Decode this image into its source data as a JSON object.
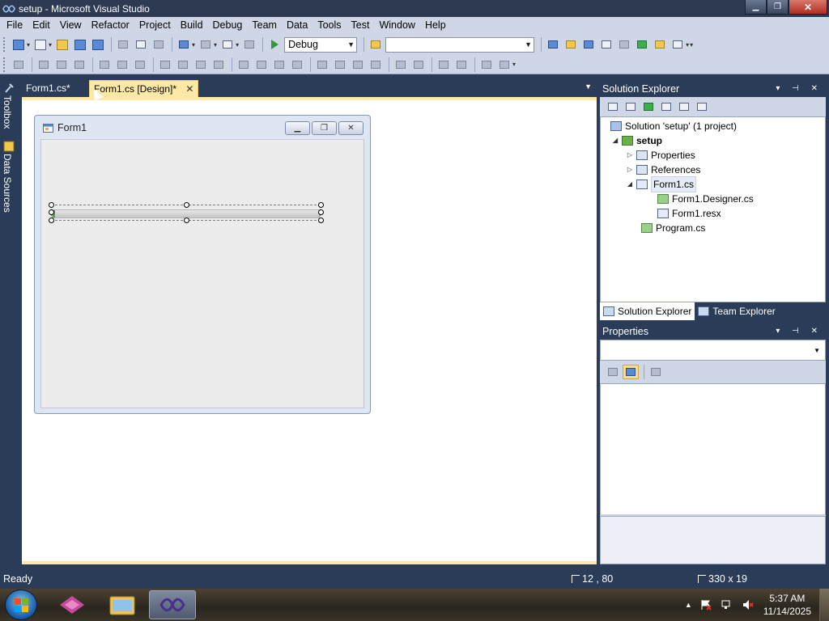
{
  "window": {
    "title": "setup - Microsoft Visual Studio",
    "min_glyph": "▁",
    "restore_glyph": "❐",
    "close_glyph": "✕"
  },
  "menu": [
    "File",
    "Edit",
    "View",
    "Refactor",
    "Project",
    "Build",
    "Debug",
    "Team",
    "Data",
    "Tools",
    "Test",
    "Window",
    "Help"
  ],
  "toolbar": {
    "configuration": "Debug",
    "find_box_value": ""
  },
  "left_strip": {
    "toolbox_label": "Toolbox",
    "data_sources_label": "Data Sources"
  },
  "doc_tabs": [
    {
      "label": "Form1.cs*",
      "active": false
    },
    {
      "label": "Form1.cs [Design]*",
      "active": true,
      "close": "✕"
    }
  ],
  "designer": {
    "form_title": "Form1",
    "progress_value": 0.01
  },
  "solution_explorer": {
    "title": "Solution Explorer",
    "pin_buttons": "▾ ⊣ ✕",
    "tree": {
      "solution": "Solution 'setup' (1 project)",
      "project": "setup",
      "properties": "Properties",
      "references": "References",
      "form1": "Form1.cs",
      "form1_designer": "Form1.Designer.cs",
      "form1_resx": "Form1.resx",
      "program": "Program.cs"
    },
    "bottom_tabs": [
      "Solution Explorer",
      "Team Explorer"
    ]
  },
  "properties_panel": {
    "title": "Properties",
    "pin_buttons": "▾ ⊣ ✕",
    "object_selector": ""
  },
  "status": {
    "text": "Ready",
    "position": "12 , 80",
    "size": "330 x 19"
  },
  "taskbar": {
    "time": "5:37 AM",
    "date": "11/14/2025"
  },
  "colors": {
    "chrome_dark": "#2b3c59",
    "toolbar": "#cfd6e5",
    "active_tab": "#fde9a5"
  }
}
